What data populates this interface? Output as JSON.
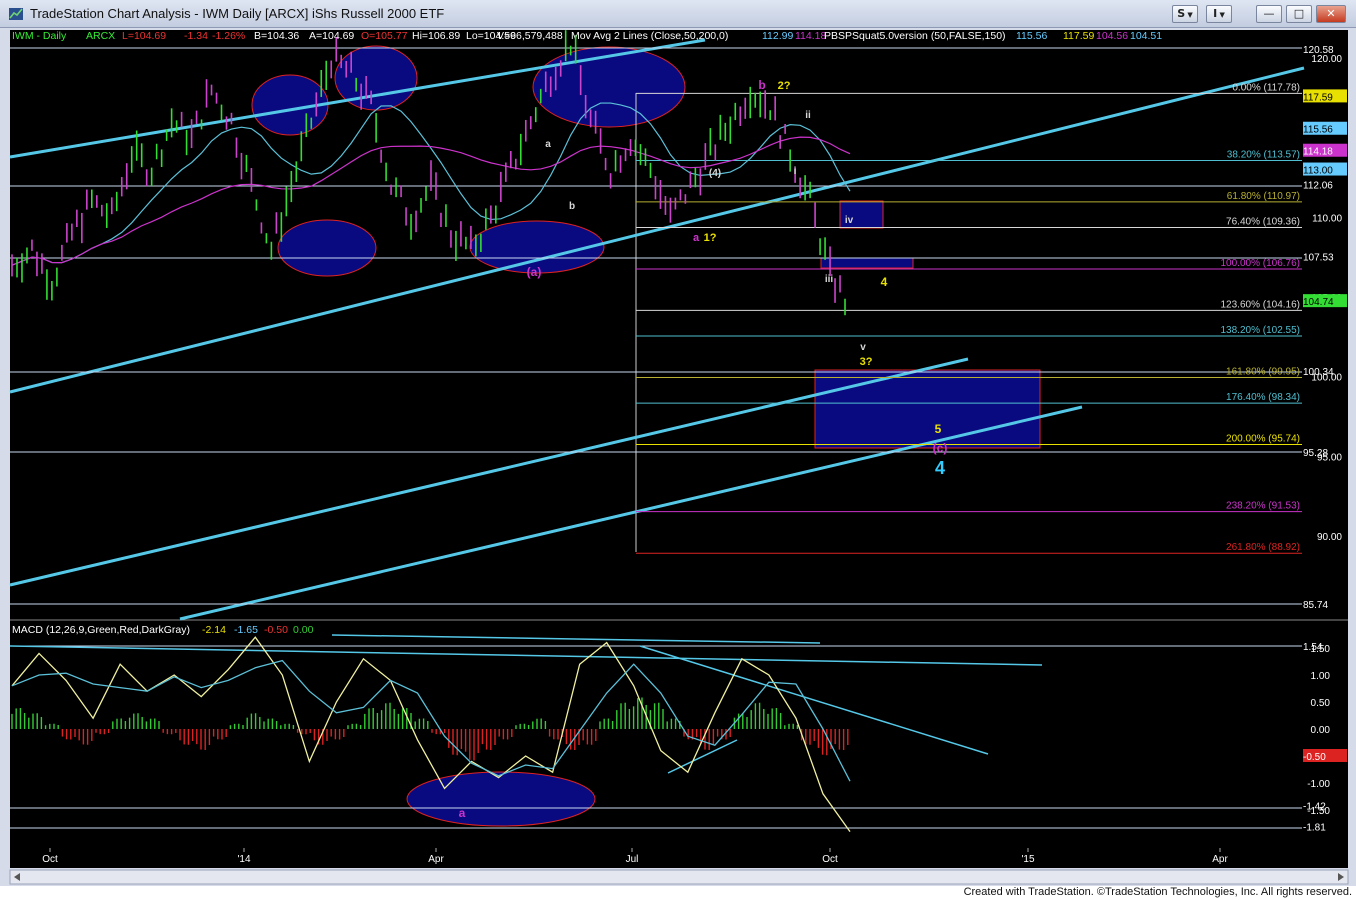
{
  "window": {
    "title": "TradeStation Chart Analysis - IWM Daily [ARCX] iShs Russell 2000 ETF",
    "buttons": {
      "symbol_btn": "S",
      "indicator_btn": "I",
      "minimize": "—",
      "restore": "□",
      "close": "✕"
    }
  },
  "footer": "Created with TradeStation. ©TradeStation Technologies, Inc. All rights reserved.",
  "colors": {
    "background": "#000000",
    "cyan": "#66ccff",
    "magenta": "#cc33cc",
    "yellow": "#e8e000",
    "green": "#22cc22",
    "red": "#dd2222",
    "ellipse": "#0a0a80"
  },
  "header_line": {
    "symbol": "IWM - Daily",
    "exchange": "ARCX",
    "last": "L=104.69",
    "change": "-1.34",
    "pct": "-1.26%",
    "bid": "B=104.36",
    "ask": "A=104.69",
    "open": "O=105.77",
    "high": "Hi=106.89",
    "low": "Lo=104.59",
    "volume": "V=66,579,488",
    "mov_avg_label": "Mov Avg 2 Lines (Close,50,200,0)",
    "ma50": "112.99",
    "ma200": "114.18",
    "pbs_label": "PBSPSquat5.0version (50,FALSE,150)",
    "pbs_v1": "115.56",
    "pbs_v2": "117.59",
    "pbs_v3": "104.56",
    "pbs_v4": "104.51"
  },
  "macd_header": {
    "label": "MACD (12,26,9,Green,Red,DarkGray)",
    "macd": "-2.14",
    "signal": "-1.65",
    "diff": "-0.50",
    "zero": "0.00"
  },
  "chart_data": {
    "type": "line",
    "title": "IWM Daily",
    "x_tick_labels": [
      "Oct",
      "'14",
      "Apr",
      "Jul",
      "Oct",
      "'15",
      "Apr"
    ],
    "y_ticks": [
      120,
      110,
      105,
      100,
      95,
      90
    ],
    "y_tick_labels": [
      "120.00",
      "110.00",
      "105.00",
      "100.00",
      "95.00",
      "90.00"
    ],
    "ylim": [
      84,
      122
    ],
    "price_path": [
      [
        0,
        107
      ],
      [
        4,
        108
      ],
      [
        8,
        106
      ],
      [
        12,
        109
      ],
      [
        16,
        111
      ],
      [
        20,
        110
      ],
      [
        24,
        114
      ],
      [
        28,
        113
      ],
      [
        32,
        116
      ],
      [
        36,
        115
      ],
      [
        40,
        118
      ],
      [
        44,
        116
      ],
      [
        48,
        112
      ],
      [
        52,
        108
      ],
      [
        56,
        112
      ],
      [
        60,
        116
      ],
      [
        64,
        120
      ],
      [
        68,
        119
      ],
      [
        72,
        117
      ],
      [
        76,
        112
      ],
      [
        80,
        110
      ],
      [
        84,
        112
      ],
      [
        88,
        109
      ],
      [
        92,
        108
      ],
      [
        96,
        110
      ],
      [
        100,
        113
      ],
      [
        104,
        116
      ],
      [
        108,
        119
      ],
      [
        112,
        121
      ],
      [
        116,
        116
      ],
      [
        120,
        113
      ],
      [
        124,
        115
      ],
      [
        128,
        113
      ],
      [
        132,
        110
      ],
      [
        136,
        112
      ],
      [
        140,
        114
      ],
      [
        144,
        116
      ],
      [
        148,
        118
      ],
      [
        152,
        117
      ],
      [
        156,
        114
      ],
      [
        160,
        111
      ],
      [
        164,
        106.5
      ],
      [
        168,
        104.2
      ]
    ],
    "fib_levels": [
      {
        "label": "0.00% (117.78)",
        "value": 117.78,
        "color": "#d8d8d8"
      },
      {
        "label": "38.20% (113.57)",
        "value": 113.57,
        "color": "#4fbfd0"
      },
      {
        "label": "61.80% (110.97)",
        "value": 110.97,
        "color": "#b7b032"
      },
      {
        "label": "76.40% (109.36)",
        "value": 109.36,
        "color": "#d8d8d8"
      },
      {
        "label": "100.00% (106.76)",
        "value": 106.76,
        "color": "#cc33cc"
      },
      {
        "label": "123.60% (104.16)",
        "value": 104.16,
        "color": "#d8d8d8"
      },
      {
        "label": "138.20% (102.55)",
        "value": 102.55,
        "color": "#4fbfd0"
      },
      {
        "label": "161.80% (99.95)",
        "value": 99.95,
        "color": "#b7b032"
      },
      {
        "label": "176.40% (98.34)",
        "value": 98.34,
        "color": "#4fbfd0"
      },
      {
        "label": "200.00% (95.74)",
        "value": 95.74,
        "color": "#e8e000"
      },
      {
        "label": "238.20% (91.53)",
        "value": 91.53,
        "color": "#cc33cc"
      },
      {
        "label": "261.80% (88.92)",
        "value": 88.92,
        "color": "#dd2222"
      }
    ],
    "right_values": [
      {
        "label": "120.58",
        "value": 120.58,
        "box": false
      },
      {
        "label": "117.59",
        "value": 117.59,
        "box": true,
        "bg": "#e8e000",
        "fg": "#000"
      },
      {
        "label": "115.56",
        "value": 115.56,
        "box": true,
        "bg": "#66ccff",
        "fg": "#000"
      },
      {
        "label": "114.18",
        "value": 114.18,
        "box": true,
        "bg": "#cc33cc",
        "fg": "#fff"
      },
      {
        "label": "113.00",
        "value": 113.0,
        "box": true,
        "bg": "#66ccff",
        "fg": "#000"
      },
      {
        "label": "112.06",
        "value": 112.06,
        "box": false
      },
      {
        "label": "107.53",
        "value": 107.53,
        "box": false
      },
      {
        "label": "104.74",
        "value": 104.74,
        "box": true,
        "bg": "#33dd33",
        "fg": "#000"
      },
      {
        "label": "100.34",
        "value": 100.34,
        "box": false
      },
      {
        "label": "95.28",
        "value": 95.28,
        "box": false
      },
      {
        "label": "85.74",
        "value": 85.74,
        "box": false
      }
    ],
    "wave_labels": [
      {
        "text": "b",
        "color": "#cc33cc"
      },
      {
        "text": "2?",
        "color": "#e8e000"
      },
      {
        "text": "ii",
        "color": "#d8d8d8"
      },
      {
        "text": "i",
        "color": "#d8d8d8"
      },
      {
        "text": "(4)",
        "color": "#d8d8d8"
      },
      {
        "text": "a",
        "color": "#d8d8d8"
      },
      {
        "text": "b",
        "color": "#d8d8d8"
      },
      {
        "text": "a",
        "color": "#cc33cc"
      },
      {
        "text": "1?",
        "color": "#e8e000"
      },
      {
        "text": "(a)",
        "color": "#cc33cc"
      },
      {
        "text": "iv",
        "color": "#d8d8d8"
      },
      {
        "text": "iii",
        "color": "#d8d8d8"
      },
      {
        "text": "4",
        "color": "#e8e000"
      },
      {
        "text": "v",
        "color": "#d8d8d8"
      },
      {
        "text": "3?",
        "color": "#e8e000"
      },
      {
        "text": "5",
        "color": "#e8e000"
      },
      {
        "text": "(c)",
        "color": "#cc33cc"
      },
      {
        "text": "4",
        "color": "#33ccff"
      },
      {
        "text": "a",
        "color": "#cc33cc"
      }
    ],
    "macd": {
      "y_tick_labels": [
        "1.50",
        "1.00",
        "0.50",
        "0.00",
        "-1.00",
        "-1.50"
      ],
      "y_ticks": [
        1.5,
        1.0,
        0.5,
        0.0,
        -1.0,
        -1.5
      ],
      "ylim": [
        -2.2,
        1.8
      ],
      "right_values": [
        {
          "label": "1.54",
          "value": 1.54
        },
        {
          "label": "-0.50",
          "value": -0.5,
          "box": true
        },
        {
          "label": "-1.42",
          "value": -1.42
        },
        {
          "label": "-1.81",
          "value": -1.81
        }
      ],
      "histogram": [
        0.4,
        0.3,
        0.1,
        -0.2,
        -0.3,
        -0.1,
        0.2,
        0.3,
        0.2,
        -0.1,
        -0.3,
        -0.4,
        -0.2,
        0.1,
        0.3,
        0.2,
        0.1,
        -0.1,
        -0.3,
        -0.2,
        0.1,
        0.4,
        0.5,
        0.4,
        0.2,
        -0.1,
        -0.5,
        -0.6,
        -0.4,
        -0.2,
        0.1,
        0.2,
        -0.2,
        -0.4,
        -0.3,
        0.2,
        0.5,
        0.6,
        0.5,
        0.2,
        -0.2,
        -0.4,
        -0.2,
        0.3,
        0.5,
        0.4,
        0.1,
        -0.3,
        -0.5,
        -0.4
      ],
      "macd_line": [
        0.8,
        1.4,
        0.9,
        0.2,
        1.2,
        0.7,
        1.0,
        0.6,
        1.1,
        1.7,
        1.0,
        -0.6,
        0.5,
        1.3,
        0.9,
        -0.2,
        -1.1,
        -0.6,
        -0.9,
        -0.5,
        -0.8,
        1.2,
        1.6,
        0.8,
        -0.4,
        -0.8,
        0.3,
        1.3,
        1.0,
        0.2,
        -1.2,
        -1.9
      ]
    }
  }
}
